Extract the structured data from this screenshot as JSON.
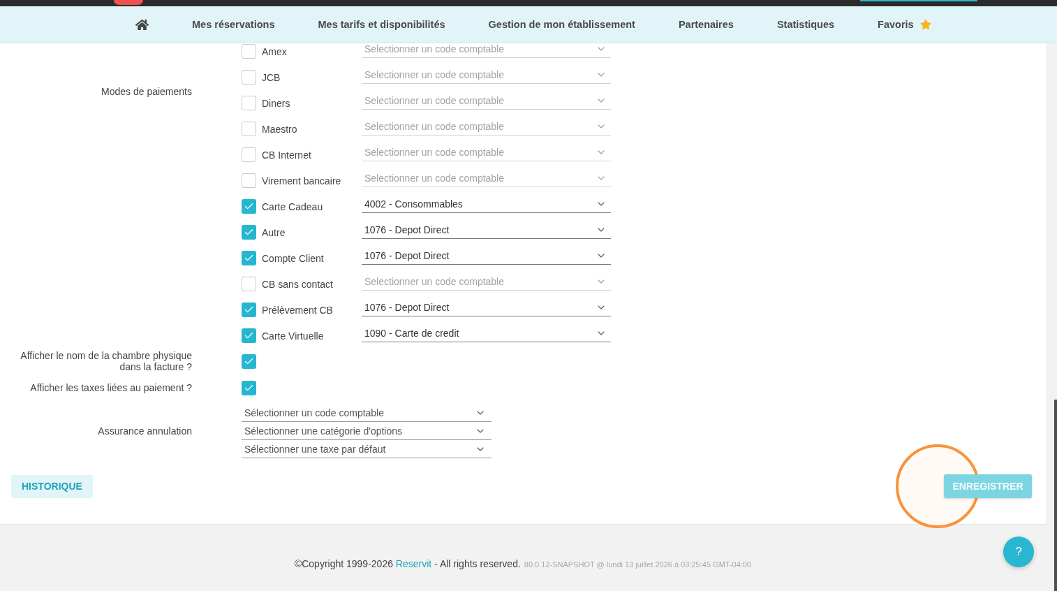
{
  "nav": {
    "items": [
      {
        "kind": "home"
      },
      {
        "kind": "link",
        "label": "Mes réservations"
      },
      {
        "kind": "link",
        "label": "Mes tarifs et disponibilités"
      },
      {
        "kind": "link",
        "label": "Gestion de mon établissement"
      },
      {
        "kind": "link",
        "label": "Partenaires"
      },
      {
        "kind": "link",
        "label": "Statistiques"
      },
      {
        "kind": "starred",
        "label": "Favoris"
      }
    ]
  },
  "payment_modes": {
    "label": "Modes de paiements",
    "items": [
      {
        "name": "Amex",
        "checked": false,
        "account": {
          "placeholder": "Selectionner un code comptable"
        }
      },
      {
        "name": "JCB",
        "checked": false,
        "account": {
          "placeholder": "Selectionner un code comptable"
        }
      },
      {
        "name": "Diners",
        "checked": false,
        "account": {
          "placeholder": "Selectionner un code comptable"
        }
      },
      {
        "name": "Maestro",
        "checked": false,
        "account": {
          "placeholder": "Selectionner un code comptable"
        }
      },
      {
        "name": "CB Internet",
        "checked": false,
        "account": {
          "placeholder": "Selectionner un code comptable"
        }
      },
      {
        "name": "Virement bancaire",
        "checked": false,
        "account": {
          "placeholder": "Selectionner un code comptable"
        }
      },
      {
        "name": "Carte Cadeau",
        "checked": true,
        "account": {
          "value": "4002 - Consommables"
        }
      },
      {
        "name": "Autre",
        "checked": true,
        "account": {
          "value": "1076 - Depot Direct"
        }
      },
      {
        "name": "Compte Client",
        "checked": true,
        "account": {
          "value": "1076 - Depot Direct"
        }
      },
      {
        "name": "CB sans contact",
        "checked": false,
        "account": {
          "placeholder": "Selectionner un code comptable"
        }
      },
      {
        "name": "Prélèvement CB",
        "checked": true,
        "account": {
          "value": "1076 - Depot Direct"
        }
      },
      {
        "name": "Carte Virtuelle",
        "checked": true,
        "account": {
          "value": "1090 - Carte de credit"
        }
      }
    ]
  },
  "options": [
    {
      "label": "Afficher le nom de la chambre physique dans la facture ?",
      "checked": true
    },
    {
      "label": "Afficher les taxes liées au paiement ?",
      "checked": true
    }
  ],
  "cancellation_insurance": {
    "label": "Assurance annulation",
    "selects": [
      {
        "placeholder": "Sélectionner un code comptable"
      },
      {
        "placeholder": "Sélectionner une catégorie d'options"
      },
      {
        "placeholder": "Sélectionner une taxe par défaut"
      }
    ]
  },
  "actions": {
    "history": {
      "label": "HISTORIQUE"
    },
    "save": {
      "label": "ENREGISTRER",
      "disabled": true
    }
  },
  "footer": {
    "copyright": "©Copyright 1999-2026",
    "link": "Reservit",
    "rights": "- All rights reserved.",
    "version": "80.0.12-SNAPSHOT @ lundi 13 juillet 2026 à 03:25:45 GMT-04:00"
  },
  "help_button": {
    "label": "?"
  }
}
